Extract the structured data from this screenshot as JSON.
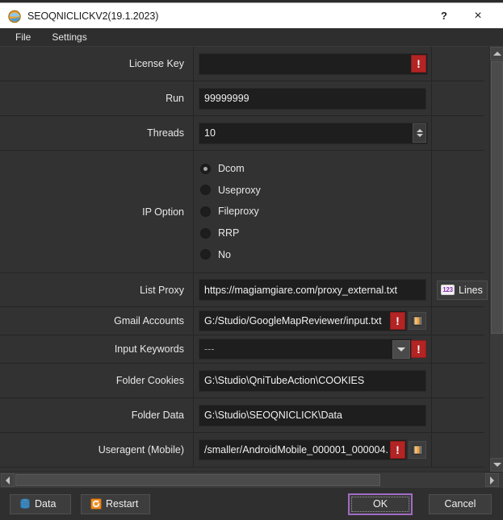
{
  "window": {
    "title": "SEOQNICLICKV2(19.1.2023)",
    "app_icon": "app-globe-icon",
    "help_label": "?",
    "close_label": "×"
  },
  "menubar": {
    "items": [
      {
        "label": "File"
      },
      {
        "label": "Settings"
      }
    ]
  },
  "form": {
    "rows": [
      {
        "label": "License Key",
        "type": "text",
        "value": "",
        "error": true,
        "error_glyph": "!"
      },
      {
        "label": "Run",
        "type": "text",
        "value": "99999999",
        "error": false
      },
      {
        "label": "Threads",
        "type": "spin",
        "value": "10",
        "error": false
      },
      {
        "label": "IP Option",
        "type": "radio",
        "options": [
          {
            "label": "Dcom",
            "selected": true
          },
          {
            "label": "Useproxy",
            "selected": false
          },
          {
            "label": "Fileproxy",
            "selected": false
          },
          {
            "label": "RRP",
            "selected": false
          },
          {
            "label": "No",
            "selected": false
          }
        ]
      },
      {
        "label": "List Proxy",
        "type": "text",
        "value": "https://magiamgiare.com/proxy_external.txt",
        "error": false,
        "extra": {
          "kind": "lines-button",
          "badge": "123",
          "label": "Lines"
        }
      },
      {
        "label": "Gmail Accounts",
        "type": "text",
        "value": "G:/Studio/GoogleMapReviewer/input.txt",
        "error": true,
        "error_glyph": "!",
        "browse": true
      },
      {
        "label": "Input Keywords",
        "type": "dropdown",
        "value": "---",
        "error": true,
        "error_glyph": "!"
      },
      {
        "label": "Folder Cookies",
        "type": "text",
        "value": "G:\\Studio\\QniTubeAction\\COOKIES",
        "error": false
      },
      {
        "label": "Folder Data",
        "type": "text",
        "value": "G:\\Studio\\SEOQNICLICK\\Data",
        "error": false
      },
      {
        "label": "Useragent (Mobile)",
        "type": "text",
        "value": "/smaller/AndroidMobile_000001_000004.",
        "error": true,
        "error_glyph": "!",
        "browse": true
      }
    ]
  },
  "footer": {
    "data_label": "Data",
    "data_icon": "database-icon",
    "restart_label": "Restart",
    "restart_icon": "restart-icon",
    "ok_label": "OK",
    "cancel_label": "Cancel"
  },
  "colors": {
    "window_bg": "#323232",
    "titlebar_bg": "#ffffff",
    "menubar_bg": "#2e2e2e",
    "input_bg": "#1e1e1e",
    "error_red": "#b32424",
    "focus_purple": "#a06bc4",
    "badge_purple": "#8b2fb5",
    "text": "#e8e8e8"
  }
}
